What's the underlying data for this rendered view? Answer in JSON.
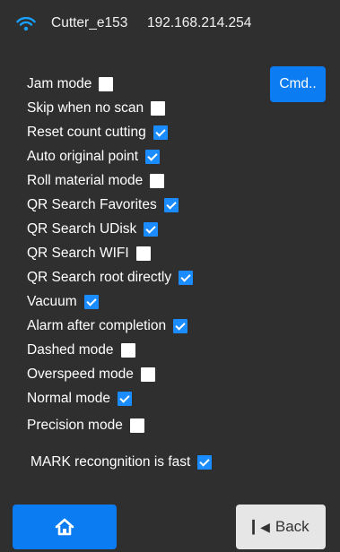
{
  "status": {
    "device": "Cutter_e153",
    "ip": "192.168.214.254"
  },
  "toolbar": {
    "cmd_label": "Cmd..",
    "back_label": "Back"
  },
  "options": [
    {
      "label": "Jam mode",
      "checked": false
    },
    {
      "label": "Skip when no scan",
      "checked": false
    },
    {
      "label": "Reset count cutting",
      "checked": true
    },
    {
      "label": "Auto original point",
      "checked": true
    },
    {
      "label": "Roll material mode",
      "checked": false
    },
    {
      "label": "QR Search Favorites",
      "checked": true
    },
    {
      "label": "QR Search UDisk",
      "checked": true
    },
    {
      "label": "QR Search WIFI",
      "checked": false
    },
    {
      "label": "QR Search root directly",
      "checked": true
    },
    {
      "label": "Vacuum",
      "checked": true
    },
    {
      "label": "Alarm after completion",
      "checked": true
    },
    {
      "label": "Dashed mode",
      "checked": false
    },
    {
      "label": "Overspeed mode",
      "checked": false
    },
    {
      "label": "Normal mode",
      "checked": true
    },
    {
      "label": "Precision mode",
      "checked": false
    },
    {
      "label": "MARK recongnition is fast",
      "checked": true
    }
  ],
  "icons": {
    "wifi": "wifi-icon",
    "home": "home-icon",
    "back": "skip-back-icon"
  },
  "colors": {
    "background": "#2f2f2f",
    "accent": "#0b7cf2",
    "checkbox_on": "#1a8cff",
    "checkbox_off": "#ffffff",
    "back_button": "#e6e6e6",
    "wifi": "#19a0ff"
  }
}
